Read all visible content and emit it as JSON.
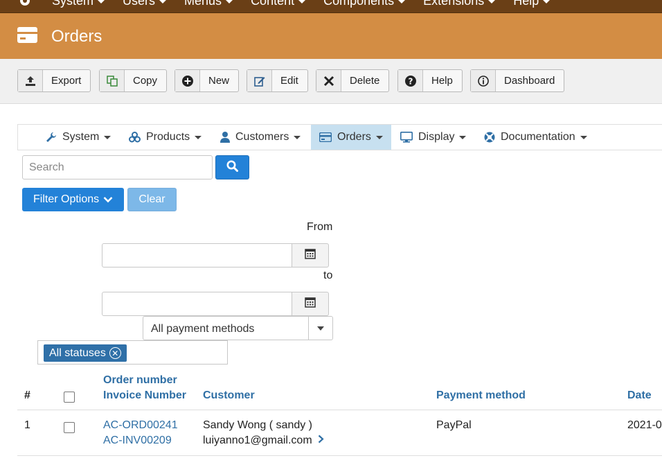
{
  "topnav": {
    "items": [
      {
        "label": "System"
      },
      {
        "label": "Users"
      },
      {
        "label": "Menus"
      },
      {
        "label": "Content"
      },
      {
        "label": "Components"
      },
      {
        "label": "Extensions"
      },
      {
        "label": "Help"
      }
    ]
  },
  "header": {
    "title": "Orders"
  },
  "toolbar": {
    "export": "Export",
    "copy": "Copy",
    "new": "New",
    "edit": "Edit",
    "delete": "Delete",
    "help": "Help",
    "dashboard": "Dashboard"
  },
  "subnav": {
    "items": [
      {
        "label": "System",
        "icon": "wrench-icon"
      },
      {
        "label": "Products",
        "icon": "cubes-icon"
      },
      {
        "label": "Customers",
        "icon": "user-icon"
      },
      {
        "label": "Orders",
        "icon": "credit-card-icon",
        "active": true
      },
      {
        "label": "Display",
        "icon": "monitor-icon"
      },
      {
        "label": "Documentation",
        "icon": "lifebuoy-icon"
      }
    ]
  },
  "search": {
    "placeholder": "Search",
    "value": ""
  },
  "filters": {
    "filter_options_label": "Filter Options",
    "clear_label": "Clear",
    "from_label": "From",
    "to_label": "to",
    "from_value": "",
    "to_value": "",
    "payment_method": "All payment methods",
    "status_chip": "All statuses"
  },
  "table": {
    "headers": {
      "index": "#",
      "order_number": "Order number",
      "invoice_number": "Invoice Number",
      "customer": "Customer",
      "payment_method": "Payment method",
      "date": "Date"
    },
    "rows": [
      {
        "index": "1",
        "order_number": "AC-ORD00241",
        "invoice_number": "AC-INV00209",
        "customer_name": "Sandy Wong ( sandy )",
        "customer_email": "luiyanno1@gmail.com",
        "payment_method": "PayPal",
        "date": "2021-0"
      }
    ]
  },
  "colors": {
    "topbar": "#6a3f16",
    "titlebar": "#d38d44",
    "primary": "#2382d8",
    "link": "#2f6fa5",
    "active_tab": "#c7e0f0"
  }
}
